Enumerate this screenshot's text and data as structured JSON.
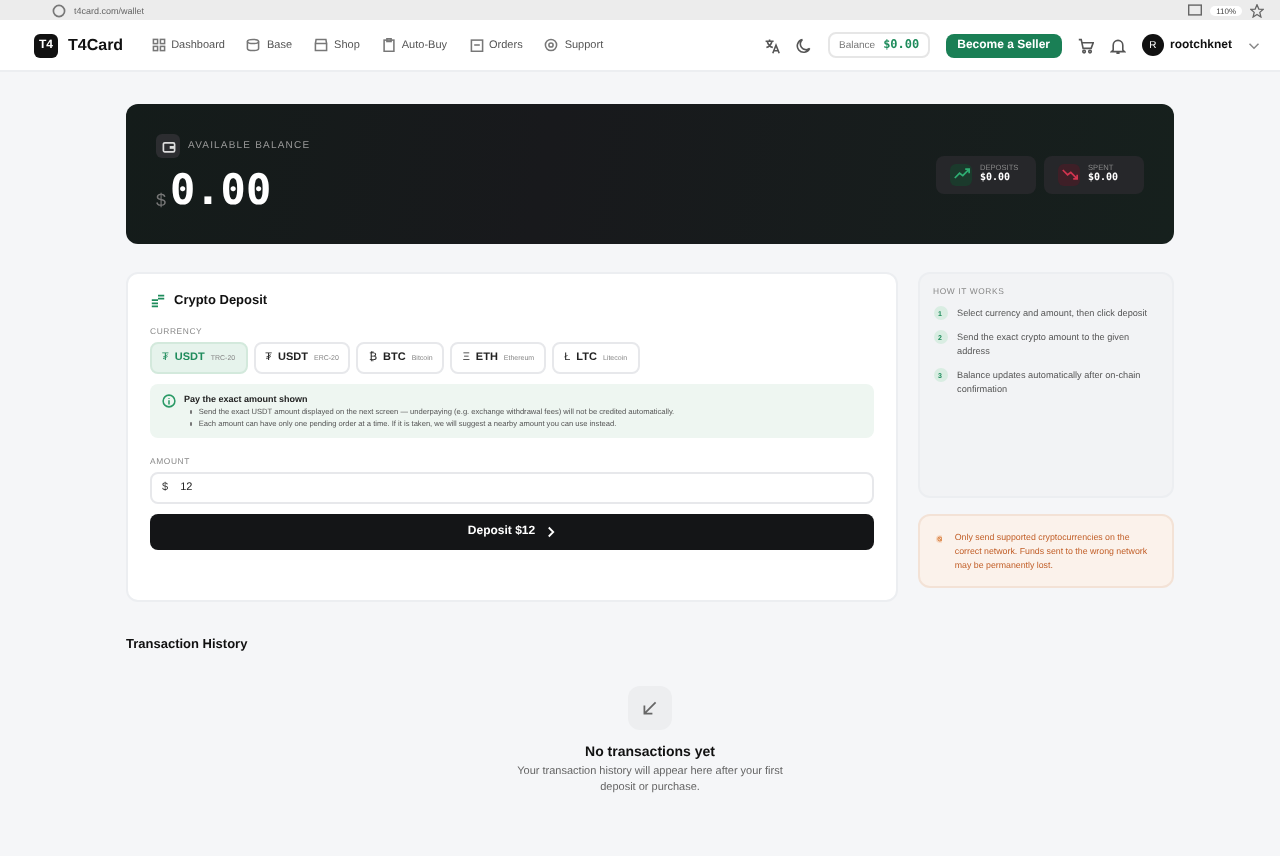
{
  "browser": {
    "address": "t4card.com/wallet",
    "zoom": "110%"
  },
  "nav": {
    "logo_mark": "T4",
    "brand": "T4Card",
    "items": [
      {
        "label": "Dashboard"
      },
      {
        "label": "Base"
      },
      {
        "label": "Shop"
      },
      {
        "label": "Auto-Buy"
      },
      {
        "label": "Orders"
      },
      {
        "label": "Support"
      }
    ],
    "balance_label": "Balance",
    "balance_value": "$0.00",
    "seller_button": "Become a Seller",
    "avatar": "R",
    "username": "rootchknet"
  },
  "balance_card": {
    "label": "AVAILABLE BALANCE",
    "currency": "$",
    "amount": "0.00",
    "stats": [
      {
        "kind": "up",
        "label": "DEPOSITS",
        "value": "$0.00"
      },
      {
        "kind": "down",
        "label": "SPENT",
        "value": "$0.00"
      }
    ]
  },
  "deposit": {
    "title": "Crypto Deposit",
    "currency_label": "CURRENCY",
    "currencies": [
      {
        "symbol": "₮",
        "code": "USDT",
        "network": "TRC-20",
        "selected": true
      },
      {
        "symbol": "₮",
        "code": "USDT",
        "network": "ERC-20",
        "selected": false
      },
      {
        "symbol": "₿",
        "code": "BTC",
        "network": "Bitcoin",
        "selected": false
      },
      {
        "symbol": "Ξ",
        "code": "ETH",
        "network": "Ethereum",
        "selected": false
      },
      {
        "symbol": "Ł",
        "code": "LTC",
        "network": "Litecoin",
        "selected": false
      }
    ],
    "notice": {
      "title": "Pay the exact amount shown",
      "points": [
        "Send the exact USDT amount displayed on the next screen — underpaying (e.g. exchange withdrawal fees) will not be credited automatically.",
        "Each amount can have only one pending order at a time. If it is taken, we will suggest a nearby amount you can use instead."
      ]
    },
    "amount_label": "AMOUNT",
    "amount_prefix": "$",
    "amount_value": "12",
    "button": "Deposit $12"
  },
  "how_it_works": {
    "title": "HOW IT WORKS",
    "steps": [
      {
        "number": "1",
        "text": "Select currency and amount, then click deposit"
      },
      {
        "number": "2",
        "text": "Send the exact crypto amount to the given address"
      },
      {
        "number": "3",
        "text": "Balance updates automatically after on-chain confirmation"
      }
    ]
  },
  "warning": "Only send supported cryptocurrencies on the correct network. Funds sent to the wrong network may be permanently lost.",
  "history": {
    "title": "Transaction History",
    "empty_title": "No transactions yet",
    "empty_text": "Your transaction history will appear here after your first deposit or purchase."
  }
}
